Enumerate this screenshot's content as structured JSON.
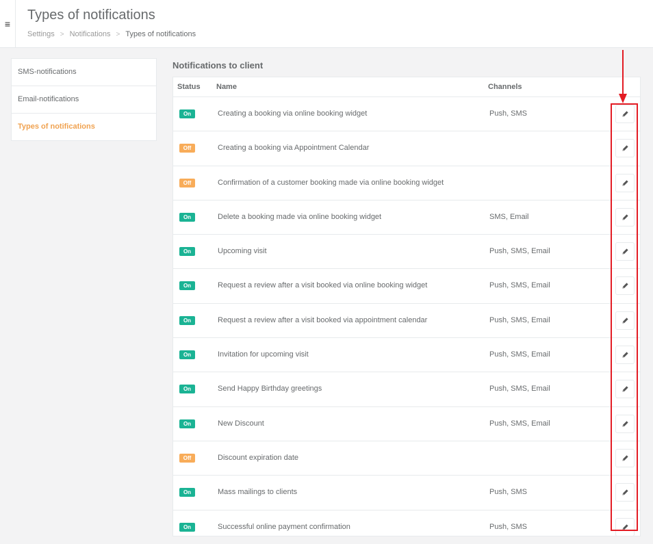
{
  "header": {
    "title": "Types of notifications",
    "menu_icon": "≡",
    "breadcrumb": [
      "Settings",
      "Notifications",
      "Types of notifications"
    ],
    "breadcrumb_separator": ">"
  },
  "sidebar": {
    "items": [
      {
        "label": "SMS-notifications"
      },
      {
        "label": "Email-notifications"
      },
      {
        "label": "Types of notifications",
        "active": true
      }
    ]
  },
  "section": {
    "title": "Notifications to client",
    "columns": {
      "status": "Status",
      "name": "Name",
      "channels": "Channels"
    }
  },
  "notifications": [
    {
      "status": "On",
      "name": "Creating a booking via online booking widget",
      "channels": "Push, SMS"
    },
    {
      "status": "Off",
      "name": "Creating a booking via Appointment Calendar",
      "channels": ""
    },
    {
      "status": "Off",
      "name": "Confirmation of a customer booking made via online booking widget",
      "channels": ""
    },
    {
      "status": "On",
      "name": "Delete a booking made via online booking widget",
      "channels": "SMS, Email"
    },
    {
      "status": "On",
      "name": "Upcoming visit",
      "channels": "Push, SMS, Email"
    },
    {
      "status": "On",
      "name": "Request a review after a visit booked via online booking widget",
      "channels": "Push, SMS, Email"
    },
    {
      "status": "On",
      "name": "Request a review after a visit booked via appointment calendar",
      "channels": "Push, SMS, Email"
    },
    {
      "status": "On",
      "name": "Invitation for upcoming visit",
      "channels": "Push, SMS, Email"
    },
    {
      "status": "On",
      "name": "Send Happy Birthday greetings",
      "channels": "Push, SMS, Email"
    },
    {
      "status": "On",
      "name": "New Discount",
      "channels": "Push, SMS, Email"
    },
    {
      "status": "Off",
      "name": "Discount expiration date",
      "channels": ""
    },
    {
      "status": "On",
      "name": "Mass mailings to clients",
      "channels": "Push, SMS"
    },
    {
      "status": "On",
      "name": "Successful online payment confirmation",
      "channels": "Push, SMS"
    }
  ],
  "colors": {
    "on": "#1ab394",
    "off": "#f8ac59",
    "active_nav": "#f0a250",
    "annotation": "#e31b23"
  },
  "icons": {
    "edit": "pencil-icon",
    "menu": "hamburger-icon"
  }
}
